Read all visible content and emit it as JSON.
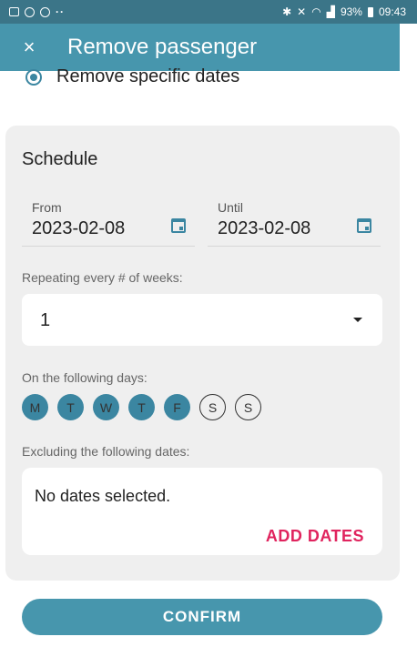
{
  "status_bar": {
    "battery": "93%",
    "time": "09:43",
    "left_icons": [
      "image-icon",
      "location-icon",
      "sync-icon",
      "more-dots-icon"
    ],
    "right_icons": [
      "bluetooth-icon",
      "mute-icon",
      "wifi-icon",
      "signal-icon",
      "battery-icon"
    ]
  },
  "app_bar": {
    "close_glyph": "×",
    "title": "Remove passenger"
  },
  "option": {
    "label": "Remove specific dates",
    "selected": true
  },
  "schedule": {
    "title": "Schedule",
    "from": {
      "label": "From",
      "value": "2023-02-08"
    },
    "until": {
      "label": "Until",
      "value": "2023-02-08"
    },
    "repeat_label": "Repeating every # of weeks:",
    "repeat_value": "1",
    "days_label": "On the following days:",
    "days": [
      {
        "letter": "M",
        "selected": true
      },
      {
        "letter": "T",
        "selected": true
      },
      {
        "letter": "W",
        "selected": true
      },
      {
        "letter": "T",
        "selected": true
      },
      {
        "letter": "F",
        "selected": true
      },
      {
        "letter": "S",
        "selected": false
      },
      {
        "letter": "S",
        "selected": false
      }
    ],
    "excluding_label": "Excluding the following dates:",
    "no_dates": "No dates selected.",
    "add_dates": "ADD DATES"
  },
  "confirm_label": "CONFIRM",
  "colors": {
    "primary": "#4796ad",
    "status_bar": "#3b7588",
    "accent": "#e0245e",
    "card": "#efefef"
  }
}
